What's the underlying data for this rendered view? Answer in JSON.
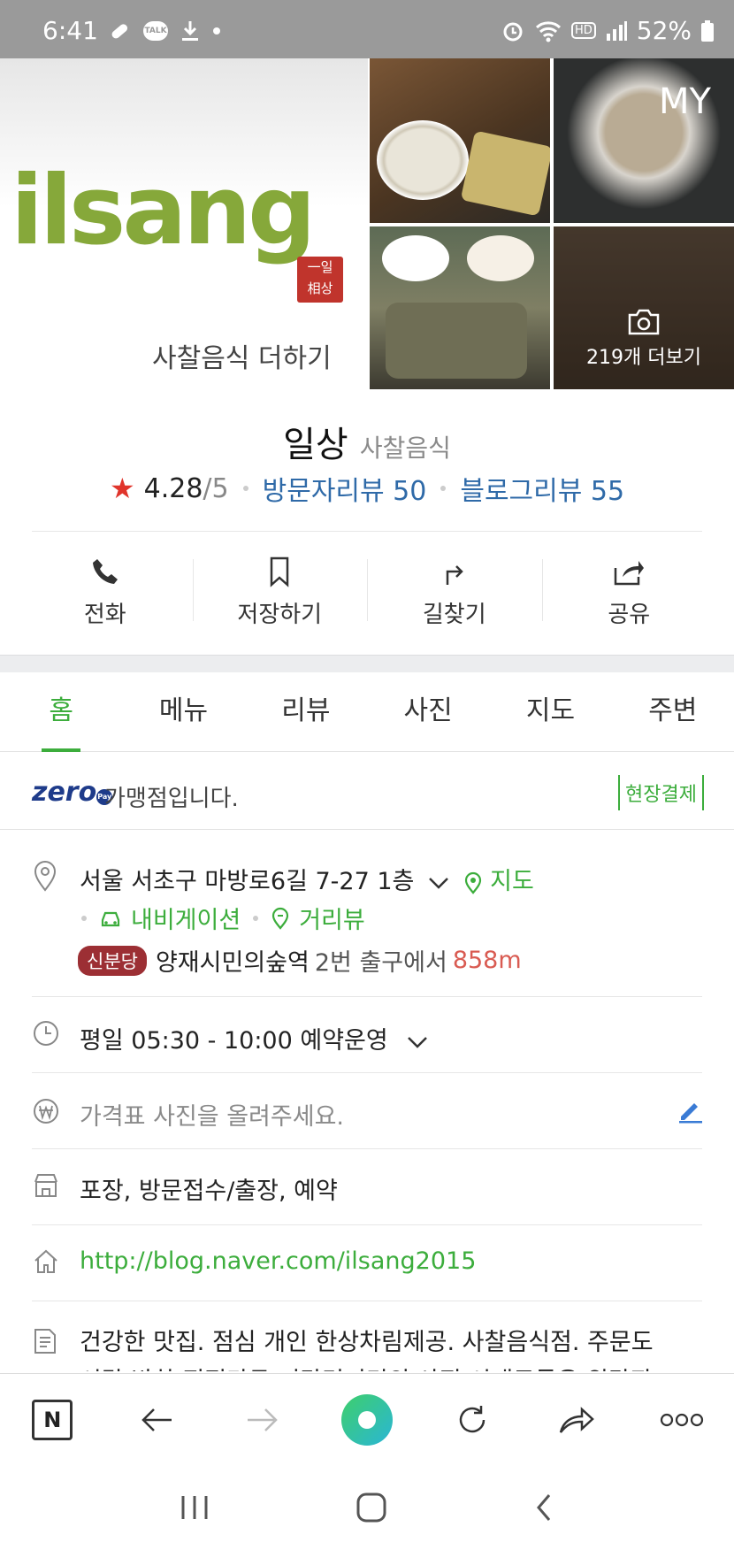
{
  "status_bar": {
    "time": "6:41",
    "battery": "52%",
    "talk_label": "TALK",
    "hd_label": "HD"
  },
  "hero": {
    "logo_text": "ilsang",
    "logo_seal": "一일\n相상",
    "logo_subtitle": "사찰음식 더하기",
    "more_photos": "219개 더보기",
    "my_label": "MY"
  },
  "place": {
    "name": "일상",
    "category": "사찰음식",
    "rating": "4.28",
    "rating_max": "/5",
    "visitor_reviews": "방문자리뷰 50",
    "blog_reviews": "블로그리뷰 55"
  },
  "actions": [
    {
      "label": "전화",
      "icon": "phone-icon"
    },
    {
      "label": "저장하기",
      "icon": "bookmark-icon"
    },
    {
      "label": "길찾기",
      "icon": "directions-icon"
    },
    {
      "label": "공유",
      "icon": "share-icon"
    }
  ],
  "tabs": [
    "홈",
    "메뉴",
    "리뷰",
    "사진",
    "지도",
    "주변"
  ],
  "active_tab": "홈",
  "zeropay": {
    "logo": "zero",
    "logo_badge": "Pay",
    "text": "가맹점입니다.",
    "onsite_badge": "현장결제"
  },
  "address": {
    "text": "서울 서초구 마방로6길 7-27 1층",
    "map_link": "지도",
    "navigation_link": "내비게이션",
    "street_view_link": "거리뷰",
    "subway_line": "신분당",
    "station": "양재시민의숲역",
    "exit_text": "2번 출구에서",
    "distance": "858m"
  },
  "hours": {
    "text": "평일 05:30 - 10:00 예약운영"
  },
  "price": {
    "placeholder": "가격표 사진을 올려주세요."
  },
  "services": {
    "text": "포장, 방문접수/출장, 예약"
  },
  "website": {
    "url": "http://blog.naver.com/ilsang2015"
  },
  "description": {
    "line1": "건강한 맛집. 점심 개인 한상차림제공. 사찰음식점. 주문도",
    "line2": "시락 반찬 진적마두 거강먹거리의 사진 시재료들은 위탁판"
  },
  "browser_bar": {
    "home_label": "N",
    "buttons": [
      "naver-home-icon",
      "back-arrow-icon",
      "forward-arrow-icon",
      "green-dot-icon",
      "refresh-icon",
      "share-arrow-icon",
      "more-icon"
    ]
  },
  "colors": {
    "accent_green": "#3cad3c",
    "link_blue": "#2f6aa8",
    "star_red": "#e0342b",
    "distance_red": "#d95b52",
    "subway_badge": "#9c2f34"
  }
}
